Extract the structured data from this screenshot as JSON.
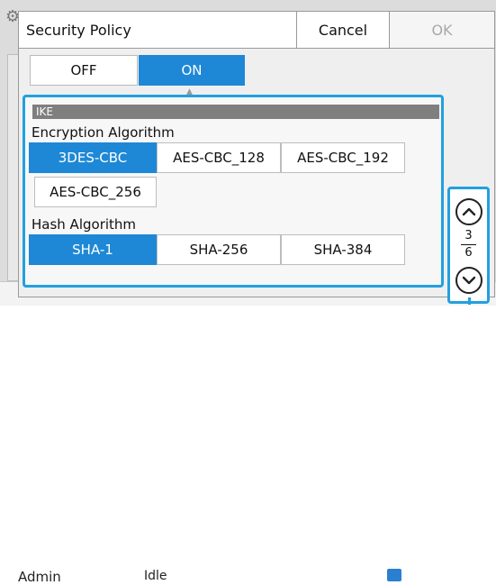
{
  "background": {
    "status_user": "Admin",
    "status_text": "Idle"
  },
  "dialog": {
    "title": "Security Policy",
    "cancel_label": "Cancel",
    "ok_label": "OK",
    "ok_enabled": false
  },
  "toggle": {
    "off_label": "OFF",
    "on_label": "ON",
    "selected": "ON"
  },
  "ike": {
    "section_label": "IKE",
    "encryption": {
      "label": "Encryption Algorithm",
      "options": [
        "3DES-CBC",
        "AES-CBC_128",
        "AES-CBC_192",
        "AES-CBC_256"
      ],
      "selected": "3DES-CBC"
    },
    "hash": {
      "label": "Hash Algorithm",
      "options": [
        "SHA-1",
        "SHA-256",
        "SHA-384"
      ],
      "selected": "SHA-1"
    }
  },
  "pager": {
    "current": "3",
    "total": "6"
  },
  "colors": {
    "accent": "#1e88d6",
    "focus": "#22a0e0"
  }
}
